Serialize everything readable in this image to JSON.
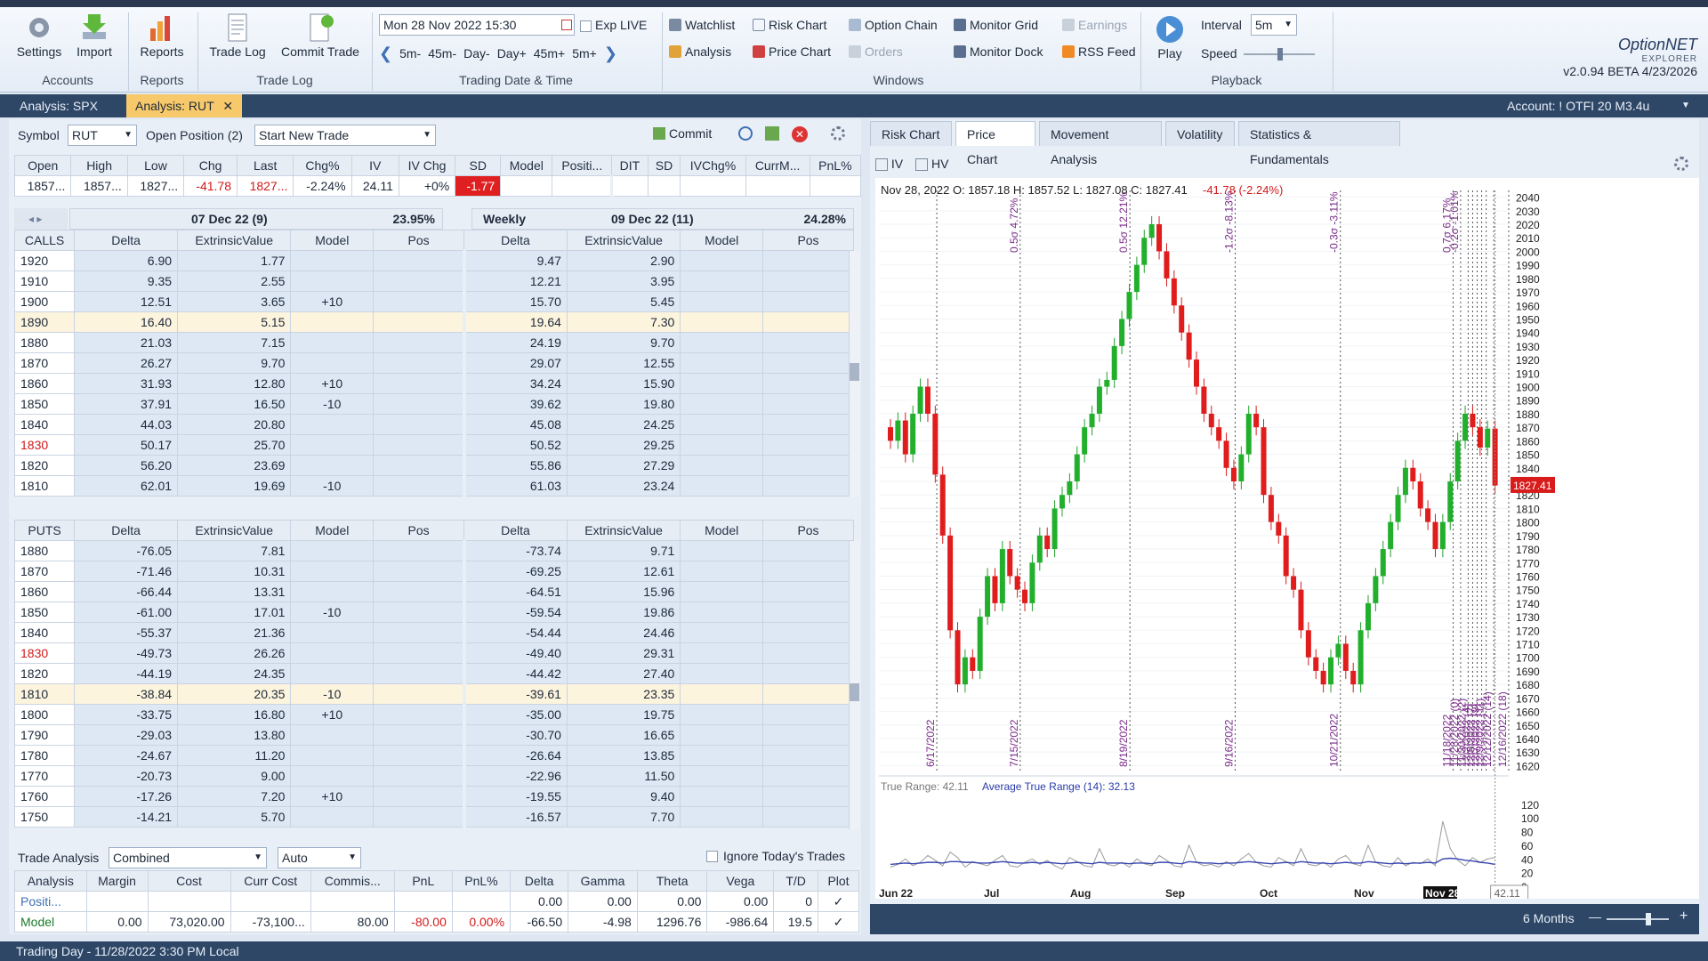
{
  "ribbon": {
    "accounts": {
      "settings": "Settings",
      "import": "Import",
      "group": "Accounts"
    },
    "reports": {
      "reports": "Reports",
      "group": "Reports"
    },
    "tradelog": {
      "trade_log": "Trade Log",
      "commit_trade": "Commit Trade",
      "group": "Trade Log"
    },
    "datetime": {
      "value": "Mon 28 Nov 2022 15:30",
      "exp": "Exp LIVE",
      "steps": [
        "5m-",
        "45m-",
        "Day-",
        "Day+",
        "45m+",
        "5m+"
      ],
      "group": "Trading Date & Time"
    },
    "windows": {
      "watchlist": "Watchlist",
      "risk_chart": "Risk Chart",
      "option_chain": "Option Chain",
      "monitor_grid": "Monitor Grid",
      "earnings": "Earnings",
      "analysis": "Analysis",
      "price_chart": "Price Chart",
      "orders": "Orders",
      "monitor_dock": "Monitor Dock",
      "rss_feed": "RSS Feed",
      "group": "Windows"
    },
    "playback": {
      "play": "Play",
      "interval_label": "Interval",
      "interval_value": "5m",
      "speed_label": "Speed",
      "group": "Playback"
    },
    "brand": {
      "name": "OptionNET",
      "sub": "EXPLORER",
      "version": "v2.0.94 BETA 4/23/2026"
    }
  },
  "doc_tabs": [
    {
      "label": "Analysis: SPX"
    },
    {
      "label": "Analysis: RUT"
    }
  ],
  "account": "Account: ! OTFI 20 M3.4u",
  "left": {
    "symbol_label": "Symbol",
    "symbol": "RUT",
    "open_position": "Open Position (2)",
    "start_trade": "Start New Trade",
    "commit": "Commit",
    "quote_headers": [
      "Open",
      "High",
      "Low",
      "Chg",
      "Last",
      "Chg%",
      "IV",
      "IV Chg",
      "SD",
      "Model",
      "Positi...",
      "DIT",
      "SD",
      "IVChg%",
      "CurrM...",
      "PnL%"
    ],
    "quote_values": [
      "1857...",
      "1857...",
      "1827...",
      "-41.78",
      "1827...",
      "-2.24%",
      "24.11",
      "+0%",
      "-1.77"
    ],
    "exp1": {
      "date": "07 Dec 22 (9)",
      "iv": "23.95%"
    },
    "exp2": {
      "label": "Weekly",
      "date": "09 Dec 22 (11)",
      "iv": "24.28%"
    },
    "calls_label": "CALLS",
    "puts_label": "PUTS",
    "col_headers": [
      "Delta",
      "ExtrinsicValue",
      "Model",
      "Pos"
    ],
    "calls": [
      [
        "1920",
        "6.90",
        "1.77",
        "",
        "",
        "9.47",
        "2.90",
        "",
        ""
      ],
      [
        "1910",
        "9.35",
        "2.55",
        "",
        "",
        "12.21",
        "3.95",
        "",
        ""
      ],
      [
        "1900",
        "12.51",
        "3.65",
        "+10",
        "",
        "15.70",
        "5.45",
        "",
        ""
      ],
      [
        "1890",
        "16.40",
        "5.15",
        "",
        "",
        "19.64",
        "7.30",
        "",
        ""
      ],
      [
        "1880",
        "21.03",
        "7.15",
        "",
        "",
        "24.19",
        "9.70",
        "",
        ""
      ],
      [
        "1870",
        "26.27",
        "9.70",
        "",
        "",
        "29.07",
        "12.55",
        "",
        ""
      ],
      [
        "1860",
        "31.93",
        "12.80",
        "+10",
        "",
        "34.24",
        "15.90",
        "",
        ""
      ],
      [
        "1850",
        "37.91",
        "16.50",
        "-10",
        "",
        "39.62",
        "19.80",
        "",
        ""
      ],
      [
        "1840",
        "44.03",
        "20.80",
        "",
        "",
        "45.08",
        "24.25",
        "",
        ""
      ],
      [
        "1830",
        "50.17",
        "25.70",
        "",
        "",
        "50.52",
        "29.25",
        "",
        ""
      ],
      [
        "1820",
        "56.20",
        "23.69",
        "",
        "",
        "55.86",
        "27.29",
        "",
        ""
      ],
      [
        "1810",
        "62.01",
        "19.69",
        "-10",
        "",
        "61.03",
        "23.24",
        "",
        ""
      ]
    ],
    "puts": [
      [
        "1880",
        "-76.05",
        "7.81",
        "",
        "",
        "-73.74",
        "9.71",
        "",
        ""
      ],
      [
        "1870",
        "-71.46",
        "10.31",
        "",
        "",
        "-69.25",
        "12.61",
        "",
        ""
      ],
      [
        "1860",
        "-66.44",
        "13.31",
        "",
        "",
        "-64.51",
        "15.96",
        "",
        ""
      ],
      [
        "1850",
        "-61.00",
        "17.01",
        "-10",
        "",
        "-59.54",
        "19.86",
        "",
        ""
      ],
      [
        "1840",
        "-55.37",
        "21.36",
        "",
        "",
        "-54.44",
        "24.46",
        "",
        ""
      ],
      [
        "1830",
        "-49.73",
        "26.26",
        "",
        "",
        "-49.40",
        "29.31",
        "",
        ""
      ],
      [
        "1820",
        "-44.19",
        "24.35",
        "",
        "",
        "-44.42",
        "27.40",
        "",
        ""
      ],
      [
        "1810",
        "-38.84",
        "20.35",
        "-10",
        "",
        "-39.61",
        "23.35",
        "",
        ""
      ],
      [
        "1800",
        "-33.75",
        "16.80",
        "+10",
        "",
        "-35.00",
        "19.75",
        "",
        ""
      ],
      [
        "1790",
        "-29.03",
        "13.80",
        "",
        "",
        "-30.70",
        "16.65",
        "",
        ""
      ],
      [
        "1780",
        "-24.67",
        "11.20",
        "",
        "",
        "-26.64",
        "13.85",
        "",
        ""
      ],
      [
        "1770",
        "-20.73",
        "9.00",
        "",
        "",
        "-22.96",
        "11.50",
        "",
        ""
      ],
      [
        "1760",
        "-17.26",
        "7.20",
        "+10",
        "",
        "-19.55",
        "9.40",
        "",
        ""
      ],
      [
        "1750",
        "-14.21",
        "5.70",
        "",
        "",
        "-16.57",
        "7.70",
        "",
        ""
      ]
    ],
    "trade_analysis": {
      "label": "Trade Analysis",
      "mode": "Combined",
      "scale": "Auto",
      "ignore": "Ignore Today's Trades",
      "headers": [
        "Analysis",
        "Margin",
        "Cost",
        "Curr Cost",
        "Commis...",
        "PnL",
        "PnL%",
        "Delta",
        "Gamma",
        "Theta",
        "Vega",
        "T/D",
        "Plot"
      ],
      "rows": [
        [
          "Positi...",
          "",
          "",
          "",
          "",
          "",
          "",
          "0.00",
          "0.00",
          "0.00",
          "0.00",
          "0",
          "✓"
        ],
        [
          "Model",
          "0.00",
          "73,020.00",
          "-73,100...",
          "80.00",
          "-80.00",
          "0.00%",
          "-66.50",
          "-4.98",
          "1296.76",
          "-986.64",
          "19.5",
          "✓"
        ]
      ]
    }
  },
  "right": {
    "tabs": [
      "Risk Chart",
      "Price Chart",
      "Movement Analysis",
      "Volatility",
      "Statistics & Fundamentals"
    ],
    "iv": "IV",
    "hv": "HV",
    "ohlc": "Nov 28, 2022 O: 1857.18 H: 1857.52 L: 1827.08 C: 1827.41",
    "ohlc_chg": "-41.78 (-2.24%)",
    "last_price": "1827.41",
    "tr_label": "True Range: 42.11",
    "atr_label": "Average True Range (14): 32.13",
    "tr_value": "42.11",
    "range": "6 Months"
  },
  "status": "Trading Day - 11/28/2022 3:30 PM Local",
  "chart_data": {
    "type": "candlestick",
    "y_ticks": [
      2040,
      2030,
      2020,
      2010,
      2000,
      1990,
      1980,
      1970,
      1960,
      1950,
      1940,
      1930,
      1920,
      1910,
      1900,
      1890,
      1880,
      1870,
      1860,
      1850,
      1840,
      1830,
      1820,
      1810,
      1800,
      1790,
      1780,
      1770,
      1760,
      1750,
      1740,
      1730,
      1720,
      1710,
      1700,
      1690,
      1680,
      1670,
      1660,
      1650,
      1640,
      1630,
      1620
    ],
    "ylim": [
      1615,
      2045
    ],
    "x_ticks": [
      "Jun 22",
      "Jul",
      "Aug",
      "Sep",
      "Oct",
      "Nov",
      "Nov 28"
    ],
    "closes": [
      1860,
      1875,
      1850,
      1880,
      1900,
      1880,
      1835,
      1790,
      1720,
      1680,
      1700,
      1690,
      1730,
      1760,
      1740,
      1780,
      1760,
      1750,
      1740,
      1770,
      1790,
      1780,
      1810,
      1820,
      1830,
      1850,
      1870,
      1880,
      1900,
      1905,
      1930,
      1950,
      1970,
      1990,
      2010,
      2020,
      2000,
      1980,
      1960,
      1940,
      1920,
      1900,
      1880,
      1870,
      1860,
      1840,
      1830,
      1850,
      1880,
      1870,
      1820,
      1800,
      1790,
      1760,
      1750,
      1720,
      1700,
      1690,
      1680,
      1700,
      1710,
      1690,
      1680,
      1720,
      1740,
      1760,
      1780,
      1800,
      1820,
      1840,
      1830,
      1810,
      1800,
      1780,
      1800,
      1830,
      1860,
      1880,
      1870,
      1855,
      1869,
      1827
    ],
    "events": [
      {
        "label": "6/17/2022",
        "sigma": ""
      },
      {
        "label": "7/15/2022",
        "sigma": "0.5σ 4.72%"
      },
      {
        "label": "8/19/2022",
        "sigma": "0.5σ 12.21%"
      },
      {
        "label": "9/16/2022",
        "sigma": "-1.2σ -8.13%"
      },
      {
        "label": "10/21/2022",
        "sigma": "-0.3σ -3.11%"
      },
      {
        "label": "11/18/2022",
        "sigma": "0.7σ 6.17%"
      },
      {
        "label": "11/28/2022 (0)",
        "sigma": "-0.2σ -1.01%"
      },
      {
        "label": "11/30/2022 (2)",
        "sigma": ""
      },
      {
        "label": "12/2/2022 (4)",
        "sigma": ""
      },
      {
        "label": "12/5/2022 (7)",
        "sigma": ""
      },
      {
        "label": "12/7/2022 (9)",
        "sigma": ""
      },
      {
        "label": "12/9/2022 (11)",
        "sigma": ""
      },
      {
        "label": "12/12/2022 (14)",
        "sigma": ""
      },
      {
        "label": "12/16/2022 (18)",
        "sigma": ""
      }
    ],
    "sub_ticks": [
      120,
      100,
      80,
      60,
      40,
      20,
      0
    ],
    "sub_ylim": [
      0,
      125
    ],
    "true_range": [
      28,
      32,
      40,
      30,
      35,
      45,
      38,
      30,
      50,
      42,
      28,
      36,
      33,
      30,
      38,
      45,
      30,
      28,
      35,
      40,
      32,
      38,
      30,
      25,
      42,
      36,
      30,
      28,
      55,
      32,
      30,
      35,
      28,
      40,
      33,
      30,
      45,
      38,
      30,
      28,
      60,
      35,
      30,
      32,
      28,
      36,
      30,
      40,
      48,
      35,
      30,
      28,
      42,
      36,
      30,
      55,
      32,
      30,
      35,
      28,
      40,
      45,
      33,
      30,
      60,
      35,
      30,
      28,
      42,
      30,
      35,
      33,
      40,
      30,
      95,
      55,
      38,
      30,
      42,
      35,
      40,
      42
    ],
    "atr": [
      32,
      33,
      34,
      33,
      34,
      35,
      35,
      34,
      36,
      36,
      35,
      35,
      34,
      34,
      35,
      36,
      35,
      34,
      34,
      35,
      34,
      35,
      34,
      33,
      34,
      35,
      34,
      33,
      35,
      34,
      34,
      34,
      33,
      34,
      34,
      33,
      35,
      35,
      34,
      33,
      36,
      35,
      34,
      34,
      33,
      34,
      34,
      35,
      36,
      35,
      34,
      33,
      34,
      35,
      34,
      36,
      35,
      34,
      34,
      33,
      34,
      35,
      34,
      34,
      36,
      35,
      34,
      33,
      34,
      33,
      34,
      34,
      35,
      34,
      40,
      41,
      40,
      38,
      37,
      35,
      34,
      32
    ]
  }
}
